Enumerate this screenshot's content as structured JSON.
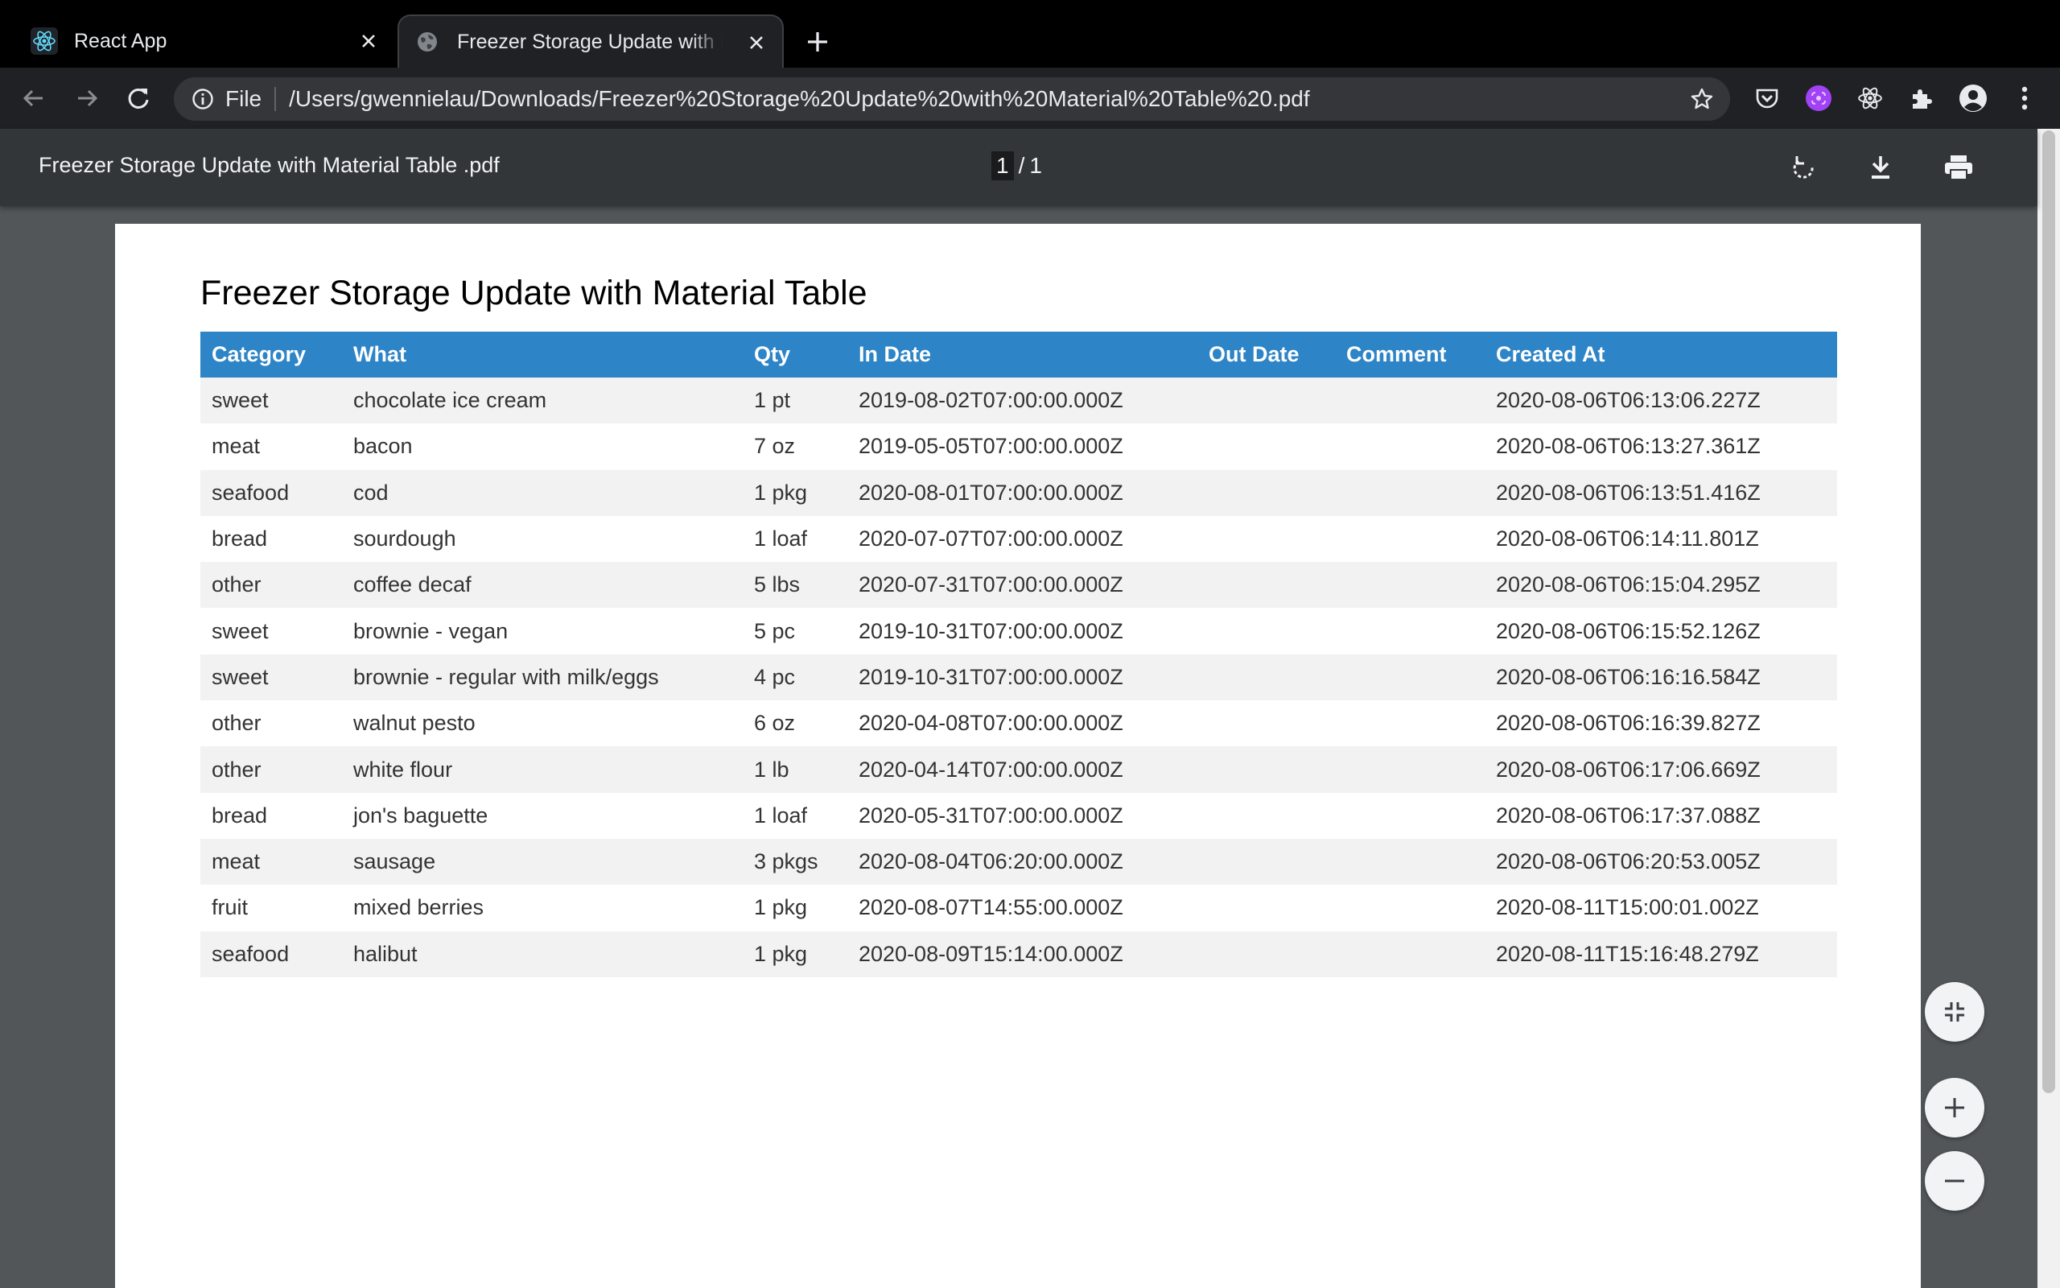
{
  "browser": {
    "tabs": [
      {
        "title": "React App",
        "icon": "react-icon",
        "active": false
      },
      {
        "title": "Freezer Storage Update with Material Table .pdf",
        "icon": "globe-icon",
        "active": true
      }
    ],
    "address": {
      "scheme_label": "File",
      "url": "/Users/gwennielau/Downloads/Freezer%20Storage%20Update%20with%20Material%20Table%20.pdf"
    }
  },
  "pdf_viewer": {
    "file_title": "Freezer Storage Update with Material Table .pdf",
    "page_current": "1",
    "page_separator": "/",
    "page_total": "1"
  },
  "document": {
    "title": "Freezer Storage Update with Material Table",
    "columns": [
      "Category",
      "What",
      "Qty",
      "In Date",
      "Out Date",
      "Comment",
      "Created At"
    ],
    "rows": [
      [
        "sweet",
        "chocolate ice cream",
        "1 pt",
        "2019-08-02T07:00:00.000Z",
        "",
        "",
        "2020-08-06T06:13:06.227Z"
      ],
      [
        "meat",
        "bacon",
        "7 oz",
        "2019-05-05T07:00:00.000Z",
        "",
        "",
        "2020-08-06T06:13:27.361Z"
      ],
      [
        "seafood",
        "cod",
        "1 pkg",
        "2020-08-01T07:00:00.000Z",
        "",
        "",
        "2020-08-06T06:13:51.416Z"
      ],
      [
        "bread",
        "sourdough",
        "1 loaf",
        "2020-07-07T07:00:00.000Z",
        "",
        "",
        "2020-08-06T06:14:11.801Z"
      ],
      [
        "other",
        "coffee decaf",
        "5 lbs",
        "2020-07-31T07:00:00.000Z",
        "",
        "",
        "2020-08-06T06:15:04.295Z"
      ],
      [
        "sweet",
        "brownie - vegan",
        "5 pc",
        "2019-10-31T07:00:00.000Z",
        "",
        "",
        "2020-08-06T06:15:52.126Z"
      ],
      [
        "sweet",
        "brownie - regular with milk/eggs",
        "4 pc",
        "2019-10-31T07:00:00.000Z",
        "",
        "",
        "2020-08-06T06:16:16.584Z"
      ],
      [
        "other",
        "walnut pesto",
        "6 oz",
        "2020-04-08T07:00:00.000Z",
        "",
        "",
        "2020-08-06T06:16:39.827Z"
      ],
      [
        "other",
        "white flour",
        "1 lb",
        "2020-04-14T07:00:00.000Z",
        "",
        "",
        "2020-08-06T06:17:06.669Z"
      ],
      [
        "bread",
        "jon's baguette",
        "1 loaf",
        "2020-05-31T07:00:00.000Z",
        "",
        "",
        "2020-08-06T06:17:37.088Z"
      ],
      [
        "meat",
        "sausage",
        "3 pkgs",
        "2020-08-04T06:20:00.000Z",
        "",
        "",
        "2020-08-06T06:20:53.005Z"
      ],
      [
        "fruit",
        "mixed berries",
        "1 pkg",
        "2020-08-07T14:55:00.000Z",
        "",
        "",
        "2020-08-11T15:00:01.002Z"
      ],
      [
        "seafood",
        "halibut",
        "1 pkg",
        "2020-08-09T15:14:00.000Z",
        "",
        "",
        "2020-08-11T15:16:48.279Z"
      ]
    ]
  },
  "colors": {
    "table_header": "#2d84c7",
    "viewer_background": "#525659",
    "viewer_toolbar": "#323639",
    "extension_accent": "#a142f4"
  }
}
